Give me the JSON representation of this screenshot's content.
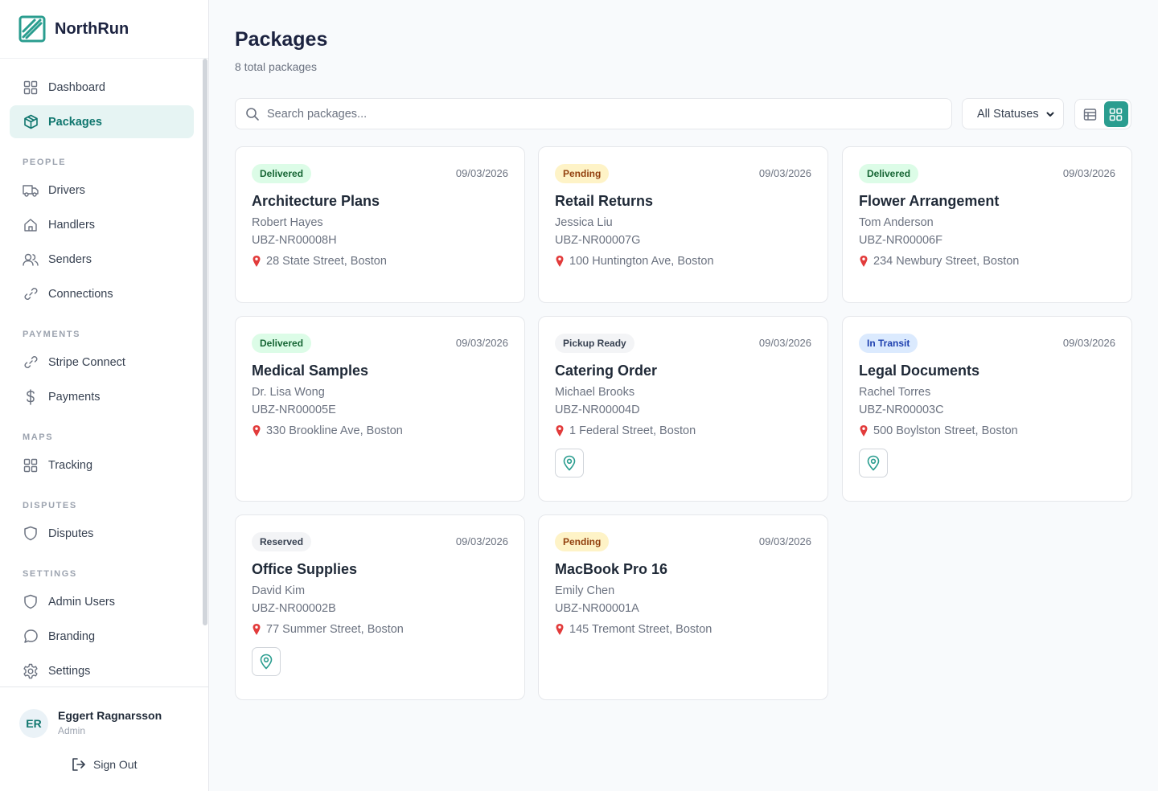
{
  "brand": {
    "name": "NorthRun"
  },
  "sidebar": {
    "nav_top": [
      {
        "label": "Dashboard",
        "icon": "grid-icon",
        "active": false
      },
      {
        "label": "Packages",
        "icon": "package-icon",
        "active": true
      }
    ],
    "sections": [
      {
        "title": "PEOPLE",
        "items": [
          {
            "label": "Drivers",
            "icon": "truck-icon"
          },
          {
            "label": "Handlers",
            "icon": "home-icon"
          },
          {
            "label": "Senders",
            "icon": "users-icon"
          },
          {
            "label": "Connections",
            "icon": "link-icon"
          }
        ]
      },
      {
        "title": "PAYMENTS",
        "items": [
          {
            "label": "Stripe Connect",
            "icon": "link-icon"
          },
          {
            "label": "Payments",
            "icon": "dollar-icon"
          }
        ]
      },
      {
        "title": "MAPS",
        "items": [
          {
            "label": "Tracking",
            "icon": "grid-icon"
          }
        ]
      },
      {
        "title": "DISPUTES",
        "items": [
          {
            "label": "Disputes",
            "icon": "shield-icon"
          }
        ]
      },
      {
        "title": "SETTINGS",
        "items": [
          {
            "label": "Admin Users",
            "icon": "shield-icon"
          },
          {
            "label": "Branding",
            "icon": "chat-icon"
          },
          {
            "label": "Settings",
            "icon": "gear-icon"
          }
        ]
      }
    ]
  },
  "user": {
    "initials": "ER",
    "name": "Eggert Ragnarsson",
    "role": "Admin",
    "sign_out_label": "Sign Out"
  },
  "page": {
    "title": "Packages",
    "subtitle": "8 total packages"
  },
  "search": {
    "placeholder": "Search packages..."
  },
  "filter": {
    "selected": "All Statuses"
  },
  "view": {
    "mode": "grid"
  },
  "status_colors": {
    "Delivered": {
      "bg": "#dcfce7",
      "fg": "#166534"
    },
    "Pending": {
      "bg": "#fef3c7",
      "fg": "#92400e"
    },
    "Pickup Ready": {
      "bg": "#f3f4f6",
      "fg": "#374151"
    },
    "In Transit": {
      "bg": "#dbeafe",
      "fg": "#1e40af"
    },
    "Reserved": {
      "bg": "#f3f4f6",
      "fg": "#374151"
    }
  },
  "accent_color": "#2a9d8f",
  "packages": [
    {
      "status": "Delivered",
      "date": "09/03/2026",
      "title": "Architecture Plans",
      "person": "Robert Hayes",
      "code": "UBZ-NR00008H",
      "address": "28 State Street, Boston",
      "map_button": false
    },
    {
      "status": "Pending",
      "date": "09/03/2026",
      "title": "Retail Returns",
      "person": "Jessica Liu",
      "code": "UBZ-NR00007G",
      "address": "100 Huntington Ave, Boston",
      "map_button": false
    },
    {
      "status": "Delivered",
      "date": "09/03/2026",
      "title": "Flower Arrangement",
      "person": "Tom Anderson",
      "code": "UBZ-NR00006F",
      "address": "234 Newbury Street, Boston",
      "map_button": false
    },
    {
      "status": "Delivered",
      "date": "09/03/2026",
      "title": "Medical Samples",
      "person": "Dr. Lisa Wong",
      "code": "UBZ-NR00005E",
      "address": "330 Brookline Ave, Boston",
      "map_button": false
    },
    {
      "status": "Pickup Ready",
      "date": "09/03/2026",
      "title": "Catering Order",
      "person": "Michael Brooks",
      "code": "UBZ-NR00004D",
      "address": "1 Federal Street, Boston",
      "map_button": true
    },
    {
      "status": "In Transit",
      "date": "09/03/2026",
      "title": "Legal Documents",
      "person": "Rachel Torres",
      "code": "UBZ-NR00003C",
      "address": "500 Boylston Street, Boston",
      "map_button": true
    },
    {
      "status": "Reserved",
      "date": "09/03/2026",
      "title": "Office Supplies",
      "person": "David Kim",
      "code": "UBZ-NR00002B",
      "address": "77 Summer Street, Boston",
      "map_button": true
    },
    {
      "status": "Pending",
      "date": "09/03/2026",
      "title": "MacBook Pro 16",
      "person": "Emily Chen",
      "code": "UBZ-NR00001A",
      "address": "145 Tremont Street, Boston",
      "map_button": false
    }
  ]
}
